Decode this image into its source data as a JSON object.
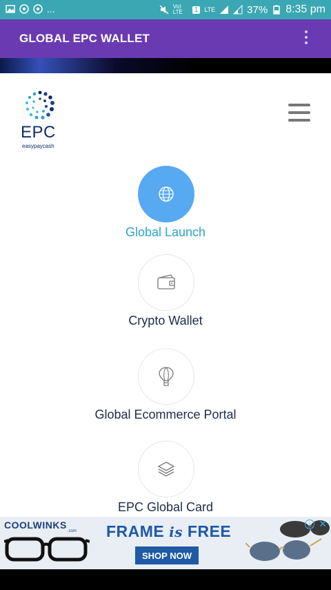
{
  "status_bar": {
    "left_more": "...",
    "battery": "37%",
    "time": "8:35 pm",
    "lte1": "Vo) LTE",
    "sim": "1",
    "lte2": "LTE"
  },
  "app_bar": {
    "title": "GLOBAL EPC WALLET"
  },
  "logo": {
    "brand": "EPC",
    "tagline": "easypaycash"
  },
  "menu": {
    "items": [
      {
        "label": "Global Launch",
        "icon": "globe-icon",
        "active": true
      },
      {
        "label": "Crypto Wallet",
        "icon": "wallet-icon",
        "active": false
      },
      {
        "label": "Global Ecommerce Portal",
        "icon": "hot-air-balloon-icon",
        "active": false
      },
      {
        "label": "EPC Global Card",
        "icon": "layers-icon",
        "active": false
      }
    ]
  },
  "ad": {
    "brand": "COOLWINKS",
    "brand_sub": ".com",
    "headline_pre": "FRAME",
    "headline_mid": "is",
    "headline_post": "FREE",
    "cta": "SHOP NOW",
    "info": "i",
    "close": "✕"
  },
  "colors": {
    "status_bar": "#3aa7b3",
    "app_bar": "#6a3ab2",
    "active_circle": "#57a9f2",
    "active_label": "#2aa4c7",
    "label": "#1e2a4a"
  }
}
